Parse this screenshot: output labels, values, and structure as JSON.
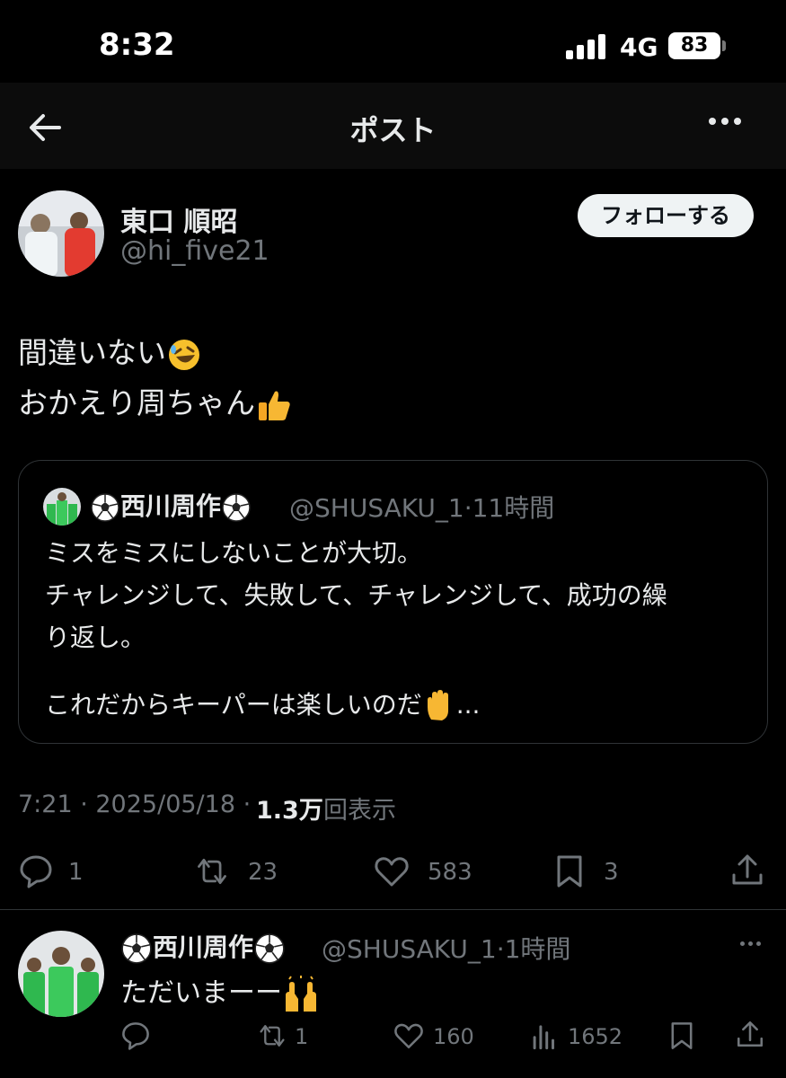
{
  "status_bar": {
    "time": "8:32",
    "network": "4G",
    "battery": "83"
  },
  "header": {
    "title": "ポスト"
  },
  "post": {
    "author": {
      "display_name": "東口 順昭",
      "handle": "@hi_five21"
    },
    "follow_label": "フォローする",
    "text_line1": "間違いない",
    "text_line1_emoji": "rolling-on-floor-laughing",
    "text_line2": "おかえり周ちゃん",
    "text_line2_emoji": "thumbs-up",
    "quote": {
      "display_name": "西川周作",
      "name_emoji": "soccer-ball",
      "meta": "@SHUSAKU_1·11時間",
      "line1": "ミスをミスにしないことが大切。",
      "line2": "チャレンジして、失敗して、チャレンジして、成功の繰",
      "line3": "り返し。",
      "line4": "これだからキーパーは楽しいのだ",
      "line4_emoji": "raised-hand",
      "line4_suffix": "..."
    },
    "timestamp": "7:21 · 2025/05/18 · ",
    "views_count": "1.3万",
    "views_label": "回表示",
    "actions": {
      "replies": "1",
      "reposts": "23",
      "likes": "583",
      "bookmarks": "3"
    }
  },
  "reply": {
    "display_name": "西川周作",
    "meta": "@SHUSAKU_1·1時間",
    "text": "ただいまーー",
    "text_emoji": "raising-hands",
    "actions": {
      "replies": "",
      "reposts": "1",
      "likes": "160",
      "views": "1652"
    }
  },
  "colors": {
    "background": "#000000",
    "text": "#e7e9ea",
    "secondary": "#71767b",
    "border": "#2f3336"
  }
}
